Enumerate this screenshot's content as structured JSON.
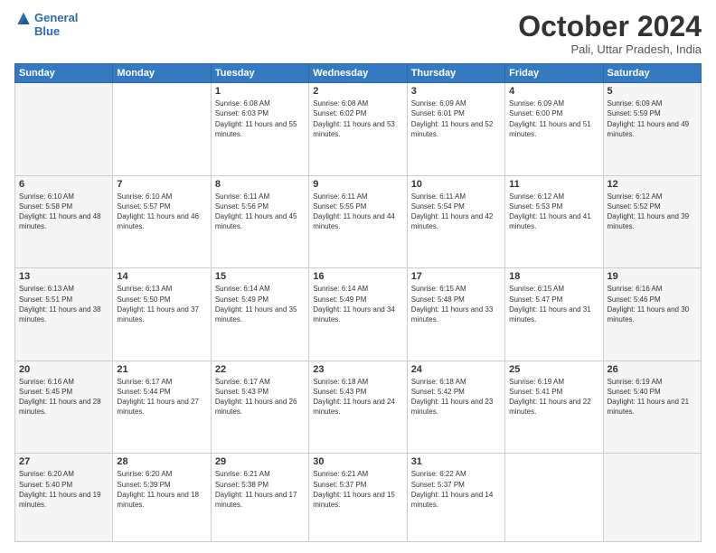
{
  "header": {
    "logo_line1": "General",
    "logo_line2": "Blue",
    "title": "October 2024",
    "subtitle": "Pali, Uttar Pradesh, India"
  },
  "columns": [
    "Sunday",
    "Monday",
    "Tuesday",
    "Wednesday",
    "Thursday",
    "Friday",
    "Saturday"
  ],
  "weeks": [
    [
      {
        "day": "",
        "info": ""
      },
      {
        "day": "",
        "info": ""
      },
      {
        "day": "1",
        "info": "Sunrise: 6:08 AM\nSunset: 6:03 PM\nDaylight: 11 hours and 55 minutes."
      },
      {
        "day": "2",
        "info": "Sunrise: 6:08 AM\nSunset: 6:02 PM\nDaylight: 11 hours and 53 minutes."
      },
      {
        "day": "3",
        "info": "Sunrise: 6:09 AM\nSunset: 6:01 PM\nDaylight: 11 hours and 52 minutes."
      },
      {
        "day": "4",
        "info": "Sunrise: 6:09 AM\nSunset: 6:00 PM\nDaylight: 11 hours and 51 minutes."
      },
      {
        "day": "5",
        "info": "Sunrise: 6:09 AM\nSunset: 5:59 PM\nDaylight: 11 hours and 49 minutes."
      }
    ],
    [
      {
        "day": "6",
        "info": "Sunrise: 6:10 AM\nSunset: 5:58 PM\nDaylight: 11 hours and 48 minutes."
      },
      {
        "day": "7",
        "info": "Sunrise: 6:10 AM\nSunset: 5:57 PM\nDaylight: 11 hours and 46 minutes."
      },
      {
        "day": "8",
        "info": "Sunrise: 6:11 AM\nSunset: 5:56 PM\nDaylight: 11 hours and 45 minutes."
      },
      {
        "day": "9",
        "info": "Sunrise: 6:11 AM\nSunset: 5:55 PM\nDaylight: 11 hours and 44 minutes."
      },
      {
        "day": "10",
        "info": "Sunrise: 6:11 AM\nSunset: 5:54 PM\nDaylight: 11 hours and 42 minutes."
      },
      {
        "day": "11",
        "info": "Sunrise: 6:12 AM\nSunset: 5:53 PM\nDaylight: 11 hours and 41 minutes."
      },
      {
        "day": "12",
        "info": "Sunrise: 6:12 AM\nSunset: 5:52 PM\nDaylight: 11 hours and 39 minutes."
      }
    ],
    [
      {
        "day": "13",
        "info": "Sunrise: 6:13 AM\nSunset: 5:51 PM\nDaylight: 11 hours and 38 minutes."
      },
      {
        "day": "14",
        "info": "Sunrise: 6:13 AM\nSunset: 5:50 PM\nDaylight: 11 hours and 37 minutes."
      },
      {
        "day": "15",
        "info": "Sunrise: 6:14 AM\nSunset: 5:49 PM\nDaylight: 11 hours and 35 minutes."
      },
      {
        "day": "16",
        "info": "Sunrise: 6:14 AM\nSunset: 5:49 PM\nDaylight: 11 hours and 34 minutes."
      },
      {
        "day": "17",
        "info": "Sunrise: 6:15 AM\nSunset: 5:48 PM\nDaylight: 11 hours and 33 minutes."
      },
      {
        "day": "18",
        "info": "Sunrise: 6:15 AM\nSunset: 5:47 PM\nDaylight: 11 hours and 31 minutes."
      },
      {
        "day": "19",
        "info": "Sunrise: 6:16 AM\nSunset: 5:46 PM\nDaylight: 11 hours and 30 minutes."
      }
    ],
    [
      {
        "day": "20",
        "info": "Sunrise: 6:16 AM\nSunset: 5:45 PM\nDaylight: 11 hours and 28 minutes."
      },
      {
        "day": "21",
        "info": "Sunrise: 6:17 AM\nSunset: 5:44 PM\nDaylight: 11 hours and 27 minutes."
      },
      {
        "day": "22",
        "info": "Sunrise: 6:17 AM\nSunset: 5:43 PM\nDaylight: 11 hours and 26 minutes."
      },
      {
        "day": "23",
        "info": "Sunrise: 6:18 AM\nSunset: 5:43 PM\nDaylight: 11 hours and 24 minutes."
      },
      {
        "day": "24",
        "info": "Sunrise: 6:18 AM\nSunset: 5:42 PM\nDaylight: 11 hours and 23 minutes."
      },
      {
        "day": "25",
        "info": "Sunrise: 6:19 AM\nSunset: 5:41 PM\nDaylight: 11 hours and 22 minutes."
      },
      {
        "day": "26",
        "info": "Sunrise: 6:19 AM\nSunset: 5:40 PM\nDaylight: 11 hours and 21 minutes."
      }
    ],
    [
      {
        "day": "27",
        "info": "Sunrise: 6:20 AM\nSunset: 5:40 PM\nDaylight: 11 hours and 19 minutes."
      },
      {
        "day": "28",
        "info": "Sunrise: 6:20 AM\nSunset: 5:39 PM\nDaylight: 11 hours and 18 minutes."
      },
      {
        "day": "29",
        "info": "Sunrise: 6:21 AM\nSunset: 5:38 PM\nDaylight: 11 hours and 17 minutes."
      },
      {
        "day": "30",
        "info": "Sunrise: 6:21 AM\nSunset: 5:37 PM\nDaylight: 11 hours and 15 minutes."
      },
      {
        "day": "31",
        "info": "Sunrise: 6:22 AM\nSunset: 5:37 PM\nDaylight: 11 hours and 14 minutes."
      },
      {
        "day": "",
        "info": ""
      },
      {
        "day": "",
        "info": ""
      }
    ]
  ]
}
